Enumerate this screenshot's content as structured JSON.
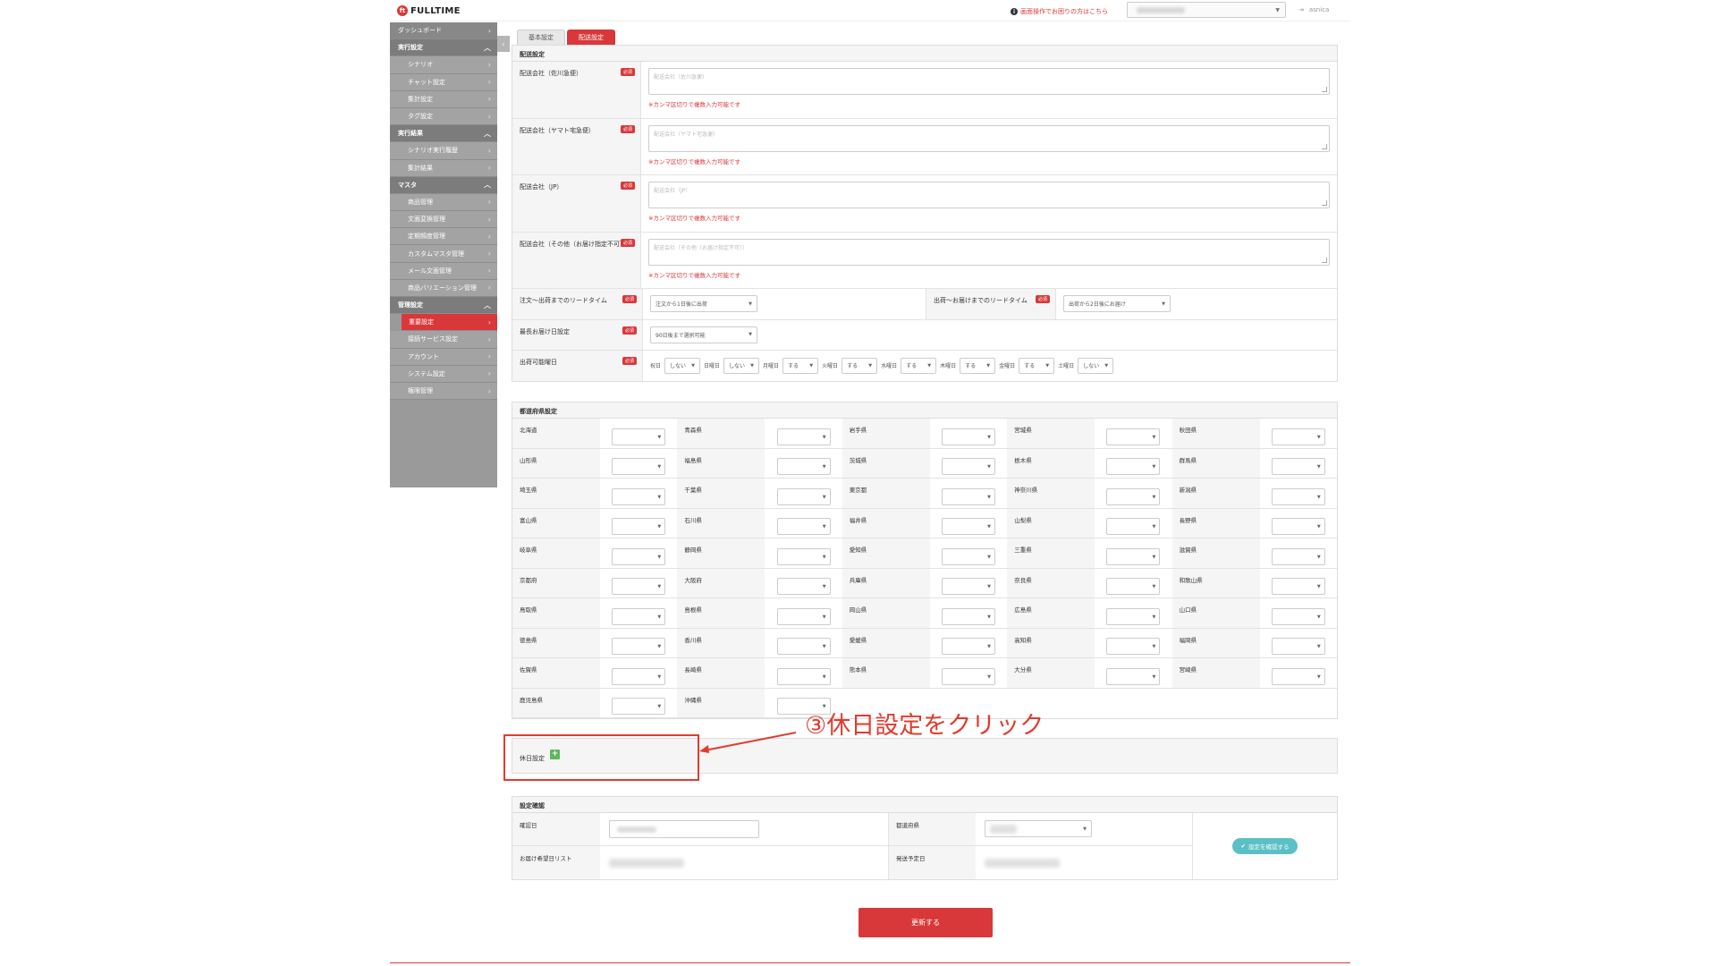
{
  "header": {
    "logo": "FULLTIME",
    "help_link": "画面操作でお困りの方はこちら",
    "account_user": "asnica"
  },
  "sidebar": {
    "items": [
      {
        "label": "ダッシュボード",
        "type": "top"
      },
      {
        "label": "実行設定",
        "type": "section"
      },
      {
        "label": "シナリオ",
        "type": "sub"
      },
      {
        "label": "チャット設定",
        "type": "sub"
      },
      {
        "label": "集計設定",
        "type": "sub"
      },
      {
        "label": "タグ設定",
        "type": "sub"
      },
      {
        "label": "実行結果",
        "type": "section"
      },
      {
        "label": "シナリオ実行履歴",
        "type": "sub"
      },
      {
        "label": "集計結果",
        "type": "sub"
      },
      {
        "label": "マスタ",
        "type": "section"
      },
      {
        "label": "商品管理",
        "type": "sub"
      },
      {
        "label": "文面変換管理",
        "type": "sub"
      },
      {
        "label": "定期頻度管理",
        "type": "sub"
      },
      {
        "label": "カスタムマスタ管理",
        "type": "sub"
      },
      {
        "label": "メール文面管理",
        "type": "sub"
      },
      {
        "label": "商品バリエーション管理",
        "type": "sub"
      },
      {
        "label": "管理設定",
        "type": "section"
      },
      {
        "label": "重要設定",
        "type": "active"
      },
      {
        "label": "接続サービス設定",
        "type": "sub"
      },
      {
        "label": "アカウント",
        "type": "sub"
      },
      {
        "label": "システム設定",
        "type": "sub"
      },
      {
        "label": "権限管理",
        "type": "sub"
      }
    ]
  },
  "tabs": {
    "basic": "基本設定",
    "delivery": "配送設定"
  },
  "delivery": {
    "title": "配送設定",
    "required": "必須",
    "carriers": [
      {
        "label": "配送会社（佐川急便）",
        "placeholder": "配送会社（佐川急便）",
        "hint": "※カンマ区切りで複数入力可能です"
      },
      {
        "label": "配送会社（ヤマト宅急便）",
        "placeholder": "配送会社（ヤマト宅急便）",
        "hint": "※カンマ区切りで複数入力可能です"
      },
      {
        "label": "配送会社（JP）",
        "placeholder": "配送会社（JP）",
        "hint": "※カンマ区切りで複数入力可能です"
      },
      {
        "label": "配送会社（その他（お届け指定不可））",
        "placeholder": "配送会社（その他（お届け指定不可））",
        "hint": "※カンマ区切りで複数入力可能です"
      }
    ],
    "lead_order_label": "注文〜出荷までのリードタイム",
    "lead_order_value": "注文から1日後に出荷",
    "lead_delivery_label": "出荷〜お届けまでのリードタイム",
    "lead_delivery_value": "出荷から2日後にお届け",
    "latest_label": "最長お届け日設定",
    "latest_value": "90日後まで選択可能",
    "weekday_label": "出荷可能曜日",
    "weekdays": [
      {
        "day": "祝日",
        "value": "しない"
      },
      {
        "day": "日曜日",
        "value": "しない"
      },
      {
        "day": "月曜日",
        "value": "する"
      },
      {
        "day": "火曜日",
        "value": "する"
      },
      {
        "day": "水曜日",
        "value": "する"
      },
      {
        "day": "木曜日",
        "value": "する"
      },
      {
        "day": "金曜日",
        "value": "する"
      },
      {
        "day": "土曜日",
        "value": "しない"
      }
    ]
  },
  "prefectures": {
    "title": "都道府県設定",
    "list": [
      "北海道",
      "青森県",
      "岩手県",
      "宮城県",
      "秋田県",
      "山形県",
      "福島県",
      "茨城県",
      "栃木県",
      "群馬県",
      "埼玉県",
      "千葉県",
      "東京都",
      "神奈川県",
      "新潟県",
      "富山県",
      "石川県",
      "福井県",
      "山梨県",
      "長野県",
      "岐阜県",
      "静岡県",
      "愛知県",
      "三重県",
      "滋賀県",
      "京都府",
      "大阪府",
      "兵庫県",
      "奈良県",
      "和歌山県",
      "鳥取県",
      "島根県",
      "岡山県",
      "広島県",
      "山口県",
      "徳島県",
      "香川県",
      "愛媛県",
      "高知県",
      "福岡県",
      "佐賀県",
      "長崎県",
      "熊本県",
      "大分県",
      "宮崎県",
      "鹿児島県",
      "沖縄県"
    ]
  },
  "holiday": {
    "label": "休日設定",
    "annotation": "③休日設定をクリック"
  },
  "confirm": {
    "title": "設定確認",
    "base_date_label": "確認日",
    "prefecture_label": "都道府県",
    "delivery_list_label": "お届け希望日リスト",
    "ship_date_label": "発送予定日",
    "confirm_button": "設定を確認する"
  },
  "update_button": "更新する",
  "colors": {
    "accent": "#d9383a",
    "confirm": "#5bc0c5",
    "plus": "#5cb85c"
  }
}
